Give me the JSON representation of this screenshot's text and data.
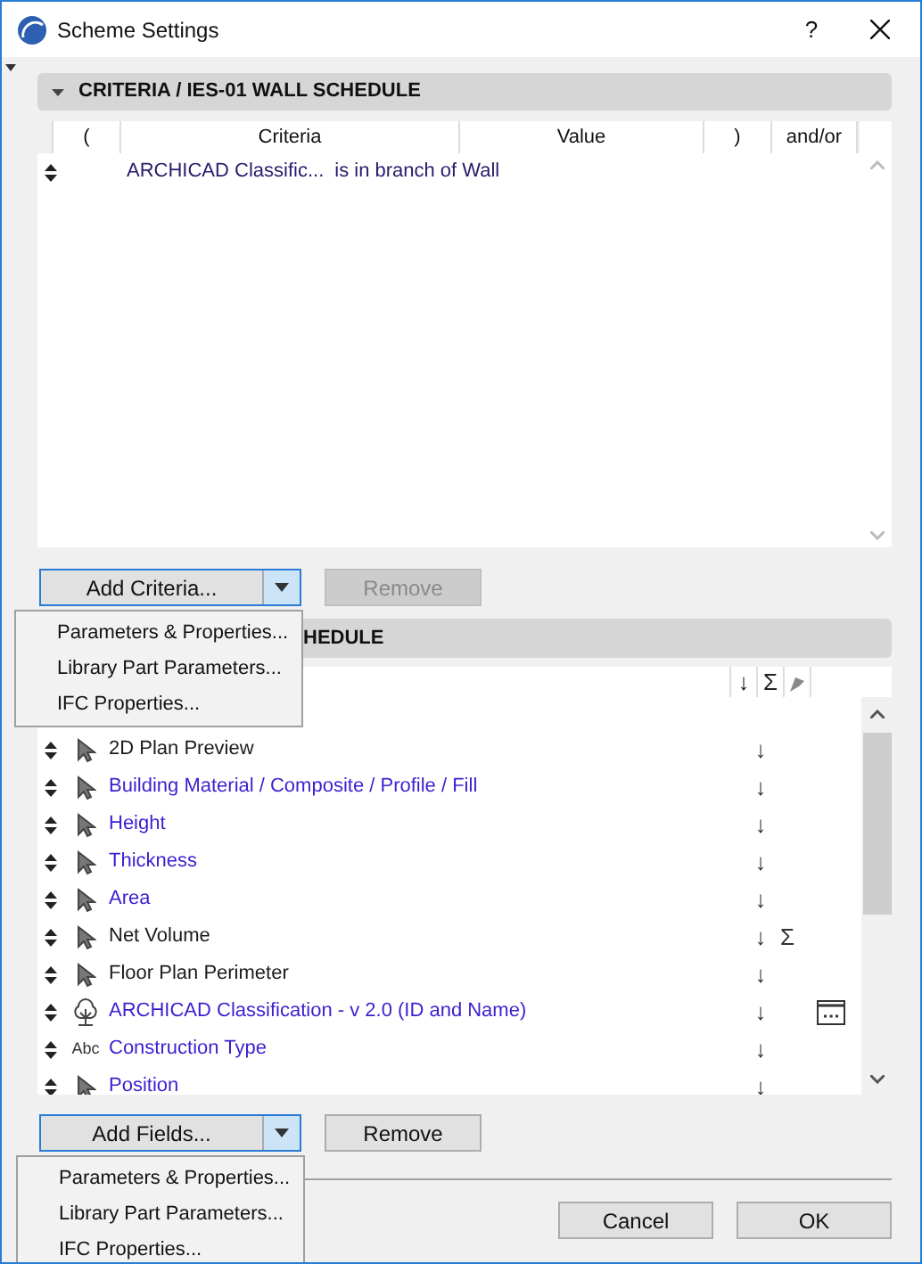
{
  "window": {
    "title": "Scheme Settings",
    "help": "?"
  },
  "criteria": {
    "header": "CRITERIA / IES-01 WALL SCHEDULE",
    "expanded": true,
    "columns": [
      "(",
      "Criteria",
      "Value",
      ")",
      "and/or"
    ],
    "rows": [
      {
        "criteria": "ARCHICAD Classific...",
        "operator": "is in branch of",
        "value": "Wall"
      }
    ],
    "add_button": "Add Criteria...",
    "remove_button": {
      "label": "Remove",
      "disabled": true
    },
    "menu": [
      "Parameters & Properties...",
      "Library Part Parameters...",
      "IFC Properties..."
    ]
  },
  "fields": {
    "header": "HEDULE",
    "columns": [
      "↓",
      "Σ"
    ],
    "rows": [
      {
        "kind": "pointer",
        "name": "2D Plan Preview",
        "color": "#1a1a1a",
        "sort": "↓"
      },
      {
        "kind": "pointer",
        "name": "Building Material / Composite / Profile / Fill",
        "color": "#3a1fd0",
        "sort": "↓"
      },
      {
        "kind": "pointer",
        "name": "Height",
        "color": "#3a1fd0",
        "sort": "↓"
      },
      {
        "kind": "pointer",
        "name": "Thickness",
        "color": "#3a1fd0",
        "sort": "↓"
      },
      {
        "kind": "pointer",
        "name": "Area",
        "color": "#3a1fd0",
        "sort": "↓"
      },
      {
        "kind": "pointer",
        "name": "Net Volume",
        "color": "#1a1a1a",
        "sort": "↓",
        "total": "Σ"
      },
      {
        "kind": "pointer",
        "name": "Floor Plan Perimeter",
        "color": "#1a1a1a",
        "sort": "↓"
      },
      {
        "kind": "tree",
        "name": "ARCHICAD Classification - v 2.0 (ID and Name)",
        "color": "#3a1fd0",
        "sort": "↓",
        "options": true
      },
      {
        "kind": "text",
        "type_label": "Abc",
        "name": "Construction Type",
        "color": "#3a1fd0",
        "sort": "↓"
      },
      {
        "kind": "pointer",
        "name": "Position",
        "color": "#3a1fd0",
        "sort": "↓"
      }
    ],
    "add_button": "Add Fields...",
    "remove_button": {
      "label": "Remove",
      "disabled": false
    },
    "menu": [
      "Parameters & Properties...",
      "Library Part Parameters...",
      "IFC Properties..."
    ]
  },
  "buttons": [
    "Cancel",
    "OK"
  ]
}
